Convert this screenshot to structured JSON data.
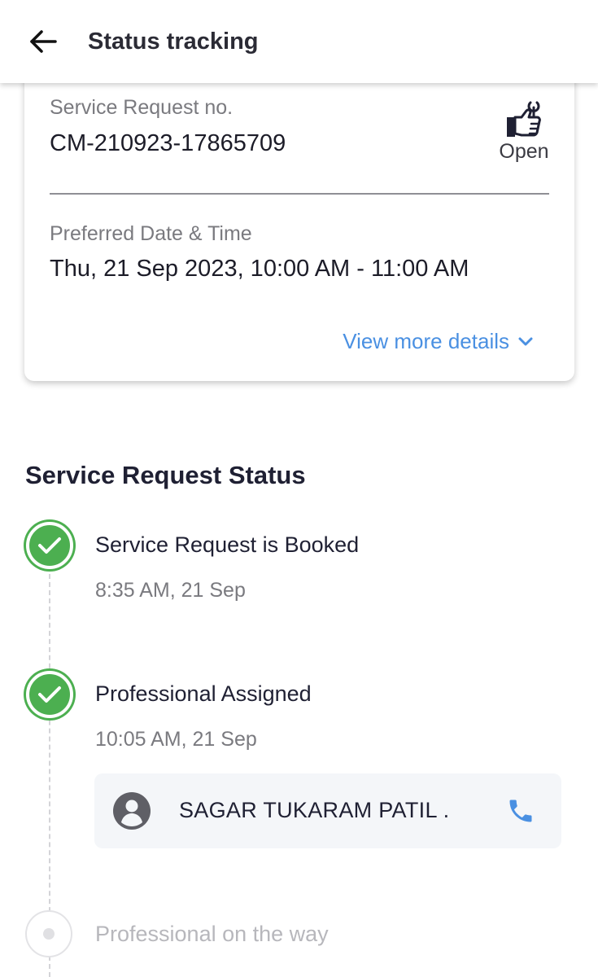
{
  "header": {
    "title": "Status tracking",
    "back_icon": "arrow-left-icon"
  },
  "request_card": {
    "sr_label": "Service Request no.",
    "sr_number": "CM-210923-17865709",
    "status_icon": "thumbs-up-wrench-icon",
    "status_text": "Open",
    "date_label": "Preferred Date & Time",
    "date_value": "Thu, 21 Sep 2023, 10:00 AM - 11:00 AM",
    "view_more_label": "View more details"
  },
  "status_section": {
    "title": "Service Request Status",
    "steps": [
      {
        "title": "Service Request is Booked",
        "time": "8:35 AM, 21 Sep",
        "state": "done"
      },
      {
        "title": "Professional Assigned",
        "time": "10:05 AM, 21 Sep",
        "state": "done"
      },
      {
        "title": "Professional on the way",
        "time": "",
        "state": "pending"
      }
    ],
    "professional": {
      "name": "SAGAR TUKARAM PATIL .",
      "avatar_icon": "person-circle-icon",
      "call_icon": "phone-icon"
    }
  },
  "colors": {
    "accent_blue": "#4a90e2",
    "success_green": "#4caf50",
    "text_dark": "#1f2033",
    "text_muted": "#7a7a7f"
  }
}
